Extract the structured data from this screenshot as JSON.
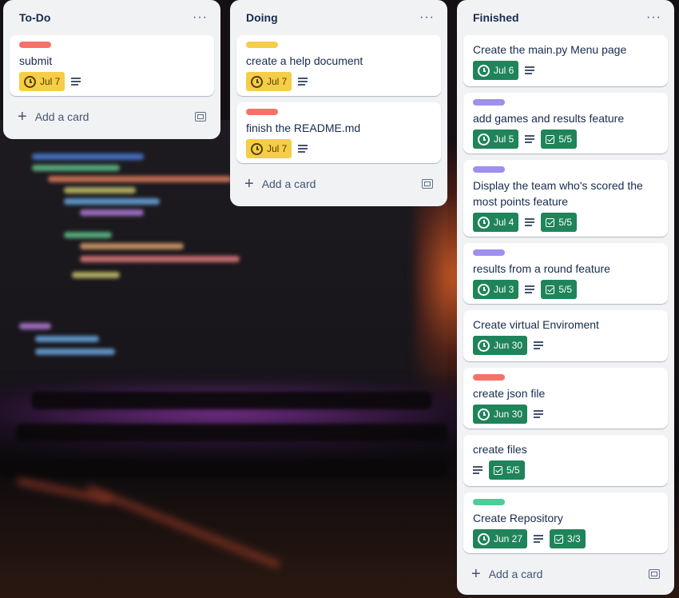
{
  "colors": {
    "label_red": "#f87168",
    "label_yellow": "#f5cd47",
    "label_purple": "#9f8fef",
    "label_green": "#4bce97",
    "due_yellow": "#f5cd47",
    "due_green": "#1f845a"
  },
  "lists": [
    {
      "title": "To-Do",
      "menu": "···",
      "add_card": "Add a card",
      "cards": [
        {
          "title": "submit",
          "label": "label_red",
          "due": "Jul 7",
          "due_style": "yellow",
          "description": true
        }
      ]
    },
    {
      "title": "Doing",
      "menu": "···",
      "add_card": "Add a card",
      "cards": [
        {
          "title": "create a help document",
          "label": "label_yellow",
          "due": "Jul 7",
          "due_style": "yellow",
          "description": true
        },
        {
          "title": "finish the README.md",
          "label": "label_red",
          "due": "Jul 7",
          "due_style": "yellow",
          "description": true
        }
      ]
    },
    {
      "title": "Finished",
      "menu": "···",
      "add_card": "Add a card",
      "cards": [
        {
          "title": "Create the main.py Menu page",
          "due": "Jul 6",
          "due_style": "green",
          "description": true
        },
        {
          "title": "add games and results feature",
          "label": "label_purple",
          "due": "Jul 5",
          "due_style": "green",
          "description": true,
          "checklist": "5/5"
        },
        {
          "title": "Display the team who's scored the most points feature",
          "label": "label_purple",
          "due": "Jul 4",
          "due_style": "green",
          "description": true,
          "checklist": "5/5"
        },
        {
          "title": "results from a round feature",
          "label": "label_purple",
          "due": "Jul 3",
          "due_style": "green",
          "description": true,
          "checklist": "5/5"
        },
        {
          "title": "Create virtual Enviroment",
          "due": "Jun 30",
          "due_style": "green",
          "description": true
        },
        {
          "title": "create json file",
          "label": "label_red",
          "due": "Jun 30",
          "due_style": "green",
          "description": true
        },
        {
          "title": "create files",
          "description": true,
          "checklist": "5/5"
        },
        {
          "title": "Create Repository",
          "label": "label_green",
          "due": "Jun 27",
          "due_style": "green",
          "description": true,
          "checklist": "3/3"
        }
      ]
    }
  ]
}
